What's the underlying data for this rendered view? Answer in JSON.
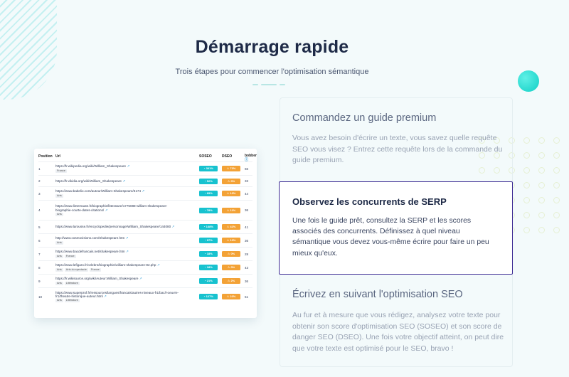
{
  "header": {
    "title": "Démarrage rapide",
    "subtitle": "Trois étapes pour commencer l'optimisation sémantique"
  },
  "table": {
    "columns": [
      "Position",
      "Url",
      "SOSEO",
      "DSEO",
      "bobber"
    ],
    "rows": [
      {
        "pos": "1",
        "url": "https://fr.wikipedia.org/wiki/William_Shakespeare",
        "url2": "",
        "tags": [
          "France"
        ],
        "soseo": "301%",
        "dseo": "73%",
        "bobber": "66"
      },
      {
        "pos": "2",
        "url": "https://fr.vikidia.org/wiki/William_Shakespeare",
        "url2": "",
        "tags": [],
        "soseo": "52%",
        "dseo": "0%",
        "bobber": "33"
      },
      {
        "pos": "3",
        "url": "https://www.babelio.com/auteur/William-Shakespeare/3174",
        "url2": "",
        "tags": [
          "Arts"
        ],
        "soseo": "69%",
        "dseo": "13%",
        "bobber": "44"
      },
      {
        "pos": "4",
        "url": "https://www.linternaute.fr/biographie/litterature/1775088-william-shakespeare-",
        "url2": "biographie-courte-dates-citations/",
        "tags": [
          "Arts"
        ],
        "soseo": "78%",
        "dseo": "11%",
        "bobber": "36"
      },
      {
        "pos": "5",
        "url": "https://www.larousse.fr/encyclopedie/personnage/William_Shakespeare/144080",
        "url2": "",
        "tags": [],
        "soseo": "148%",
        "dseo": "41%",
        "bobber": "41"
      },
      {
        "pos": "6",
        "url": "http://www.cosmovisions.com/Shakespeare.htm",
        "url2": "",
        "tags": [
          "Arts"
        ],
        "soseo": "97%",
        "dseo": "13%",
        "bobber": "36"
      },
      {
        "pos": "7",
        "url": "https://www.bacdefrancais.net/shakespeare.htm",
        "url2": "",
        "tags": [
          "Arts",
          "France"
        ],
        "soseo": "18%",
        "dseo": "0%",
        "bobber": "28"
      },
      {
        "pos": "8",
        "url": "https://www.lefigaro.fr/celebre/biographie/william-shakespeare-82.php",
        "url2": "",
        "tags": [
          "Arts",
          "Arts du spectacle",
          "France"
        ],
        "soseo": "18%",
        "dseo": "0%",
        "bobber": "43"
      },
      {
        "pos": "9",
        "url": "https://fr.wikisource.org/wiki/Auteur:William_Shakespeare",
        "url2": "",
        "tags": [
          "Arts",
          "Littérature"
        ],
        "soseo": "21%",
        "dseo": "2%",
        "bobber": "36"
      },
      {
        "pos": "10",
        "url": "https://www.superprof.fr/ressources/langues/francais/autres-niveaux-fr1/bac/l-oeuvre-",
        "url2": "fr1/theatre-historique-auteur.html",
        "tags": [
          "Arts",
          "Littérature"
        ],
        "soseo": "127%",
        "dseo": "23%",
        "bobber": "51"
      }
    ]
  },
  "steps": [
    {
      "title": "Commandez un guide premium",
      "text": "Vous avez besoin d'écrire un texte, vous savez quelle requête SEO vous visez ? Entrez cette requête lors de la commande du guide premium."
    },
    {
      "title": "Observez les concurrents de SERP",
      "text": "Une fois le guide prêt, consultez la SERP et les scores associés des concurrents. Définissez à quel niveau sémantique vous devez vous-même écrire pour faire un peu mieux qu'eux."
    },
    {
      "title": "Écrivez en suivant l'optimisation SEO",
      "text": "Au fur et à mesure que vous rédigez, analysez votre texte pour obtenir son score d'optimisation SEO (SOSEO) et son score de danger SEO (DSEO). Une fois votre objectif atteint, on peut dire que votre texte est optimisé pour le SEO, bravo !"
    }
  ],
  "icons": {
    "external_link": "external-link-icon",
    "score": "gauge-icon",
    "warning": "warning-icon",
    "help": "help-icon"
  },
  "colors": {
    "accent_teal": "#17c2cf",
    "warning_orange": "#f3a236",
    "active_border": "#3c2a93",
    "title": "#1e2a47"
  }
}
